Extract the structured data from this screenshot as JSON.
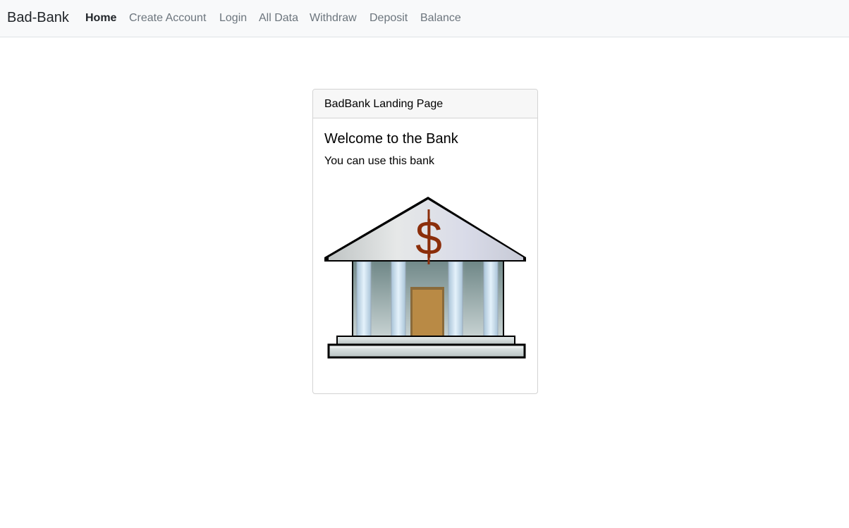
{
  "navbar": {
    "brand": "Bad-Bank",
    "items": [
      {
        "label": "Home",
        "active": true
      },
      {
        "label": "Create Account",
        "active": false
      },
      {
        "label": "Login",
        "active": false
      },
      {
        "label": "All Data",
        "active": false
      },
      {
        "label": "Withdraw",
        "active": false
      },
      {
        "label": "Deposit",
        "active": false
      },
      {
        "label": "Balance",
        "active": false
      }
    ]
  },
  "card": {
    "header": "BadBank Landing Page",
    "title": "Welcome to the Bank",
    "text": "You can use this bank",
    "image_icon": "bank-building-icon",
    "image_symbol": "$"
  },
  "colors": {
    "navbar_bg": "#f8f9fa",
    "nav_active": "#212529",
    "nav_inactive": "#6c757d",
    "dollar": "#8b2e0b",
    "door": "#b98a45"
  }
}
